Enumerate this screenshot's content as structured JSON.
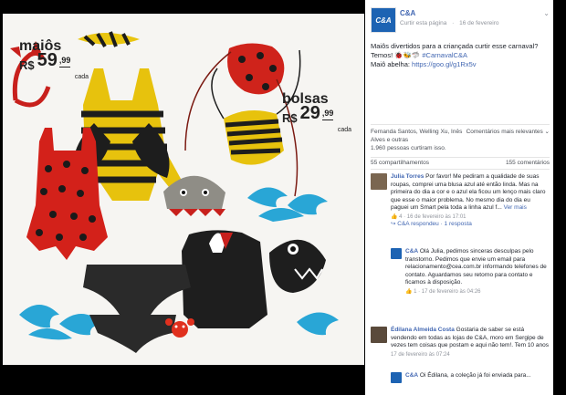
{
  "photo": {
    "maios_label": "maiôs",
    "maios_currency": "R$",
    "maios_price": "59",
    "maios_cents": ",99",
    "maios_unit": "cada",
    "bolsas_label": "bolsas",
    "bolsas_currency": "R$",
    "bolsas_price": "29",
    "bolsas_cents": ",99",
    "bolsas_unit": "cada"
  },
  "header": {
    "page_name": "C&A",
    "avatar_text": "C&A",
    "like_page": "Curtir esta página",
    "separator": "·",
    "date": "16 de fevereiro",
    "menu": "⌄"
  },
  "post": {
    "text_1": "Maiôs divertidos para a criançada curtir esse carnaval? Temos! 🐞🐝🦈 ",
    "hashtag": "#CarnavalC&A",
    "text_2": "Maiô abelha: ",
    "link": "https://goo.gl/g1Rx5v"
  },
  "likes": {
    "names": "Fernanda Santos, Welling Xu, Inês Alves e outras",
    "count": "1.960 pessoas curtiram isso.",
    "sort": "Comentários mais relevantes ⌄"
  },
  "counts": {
    "shares": "55 compartilhamentos",
    "comments": "155 comentários"
  },
  "comments": [
    {
      "author": "Julia Torres",
      "text": " Por favor! Me pediram a qualidade de suas roupas, comprei uma blusa azul até então linda. Mas na primeira do dia a cor e o azul ela ficou um lenço mais claro que esse o maior problema. No mesmo dia do dia eu paguei um Smart pela toda a linha azul f...",
      "more": "Ver mais",
      "meta": "👍 4 · 16 de fevereiro às 17:01",
      "reply": "↪ C&A respondeu · 1 resposta"
    },
    {
      "author": "C&A",
      "text": " Olá Julia, pedimos sinceras desculpas pelo transtorno. Pedimos que envie um email para relacionamento@cea.com.br informando telefones de contato. Aguardamos seu retorno para contato e ficamos à disposição.",
      "meta": "👍 1 · 17 de fevereiro às 04:26"
    },
    {
      "author": "Édilana Almeida Costa",
      "text": " Gostaria de saber se está vendendo em todas as lojas de C&A, moro em Sergipe de vezes tem coisas que postam e aqui não tem!. Tem 10 anos",
      "meta": "17 de fevereiro às 07:24"
    },
    {
      "author": "C&A",
      "text": " Oi Édilana, a coleção já foi enviada para..."
    }
  ]
}
